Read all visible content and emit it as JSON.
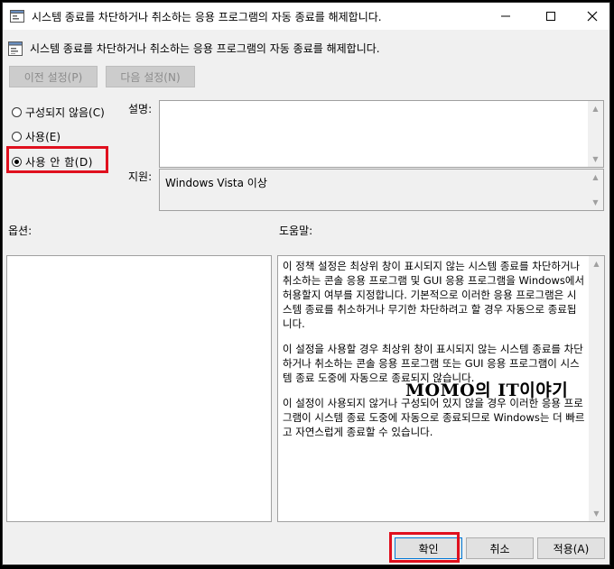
{
  "window": {
    "title": "시스템 종료를 차단하거나 취소하는 응용 프로그램의 자동 종료를 해제합니다.",
    "minimize_glyph": "—",
    "maximize_glyph": "☐",
    "close_glyph": "✕"
  },
  "header": {
    "policy_title": "시스템 종료를 차단하거나 취소하는 응용 프로그램의 자동 종료를 해제합니다."
  },
  "nav": {
    "prev_label": "이전 설정(P)",
    "next_label": "다음 설정(N)"
  },
  "options": {
    "not_configured_label": "구성되지 않음(C)",
    "enabled_label": "사용(E)",
    "disabled_label": "사용 안 함(D)",
    "selected": "disabled"
  },
  "comment": {
    "label": "설명:",
    "value": ""
  },
  "supported_on": {
    "label": "지원:",
    "value": "Windows Vista 이상"
  },
  "sections": {
    "options_label": "옵션:",
    "help_label": "도움말:"
  },
  "help": {
    "paragraphs": [
      "이 정책 설정은 최상위 창이 표시되지 않는 시스템 종료를 차단하거나 취소하는 콘솔 응용 프로그램 및 GUI 응용 프로그램을 Windows에서 허용할지 여부를 지정합니다. 기본적으로 이러한 응용 프로그램은 시스템 종료를 취소하거나 무기한 차단하려고 할 경우 자동으로 종료됩니다.",
      "이 설정을 사용할 경우 최상위 창이 표시되지 않는 시스템 종료를 차단하거나 취소하는 콘솔 응용 프로그램 또는 GUI 응용 프로그램이 시스템 종료 도중에 자동으로 종료되지 않습니다.",
      "이 설정이 사용되지 않거나 구성되어 있지 않을 경우 이러한 응용 프로그램이 시스템 종료 도중에 자동으로 종료되므로 Windows는 더 빠르고 자연스럽게 종료할 수 있습니다."
    ]
  },
  "buttons": {
    "ok_label": "확인",
    "cancel_label": "취소",
    "apply_label": "적용(A)"
  },
  "watermark": "MOMO의 IT이야기",
  "colors": {
    "highlight": "#e0101e",
    "window_bg": "#f0f0f0"
  }
}
